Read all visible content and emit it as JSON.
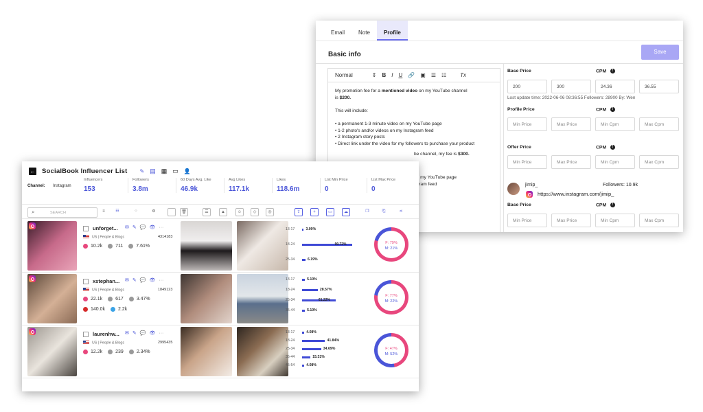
{
  "profile_window": {
    "tabs": [
      "Email",
      "Note",
      "Profile"
    ],
    "active_tab": "Profile",
    "section_title": "Basic info",
    "save_label": "Save",
    "editor_toolbar": {
      "format": "Normal",
      "bold": "B",
      "italic": "I",
      "underline": "U",
      "clear": "Tx"
    },
    "editor_lines": [
      {
        "pre": "My promotion fee for a ",
        "bold": "mentioned video",
        "post": " on my YouTube channel"
      },
      {
        "pre": "is ",
        "bold": "$200.",
        "post": ""
      },
      {
        "pre": "",
        "bold": "",
        "post": ""
      },
      {
        "pre": "This will include:",
        "bold": "",
        "post": ""
      },
      {
        "pre": "",
        "bold": "",
        "post": ""
      },
      {
        "pre": "• a permanent 1-3 minute video on my YouTube page",
        "bold": "",
        "post": ""
      },
      {
        "pre": "• 1-2 photo's and/or videos on my Instagram feed",
        "bold": "",
        "post": ""
      },
      {
        "pre": "• 2 Instagram story posts",
        "bold": "",
        "post": ""
      },
      {
        "pre": "• Direct link under the video for my followers to purchase your product",
        "bold": "",
        "post": ""
      }
    ],
    "editor_hidden_lines": [
      {
        "text": "be channel, my fee is ",
        "bold": "$300."
      },
      {
        "text": "on my YouTube page",
        "bold": ""
      },
      {
        "text": "agram feed",
        "bold": ""
      }
    ],
    "base_price_label": "Base Price",
    "cpm_label": "CPM",
    "base_prices": [
      "200",
      "300",
      "24.36",
      "36.55"
    ],
    "update_note": "Lost update time: 2022-06-06 08:36:55 Followers: 28900 By: Wen",
    "profile_price_label": "Profile Price",
    "offer_price_label": "Offer Price",
    "placeholders": {
      "min_price": "Min Price",
      "max_price": "Max Price",
      "min_cpm": "Min Cpm",
      "max_cpm": "Max Cpm"
    },
    "account": {
      "handle": "jimip_",
      "followers": "Followers: 10.9k",
      "url": "https://www.instagram.com/jimip_"
    },
    "account_base_price_label": "Base Price",
    "account_cpm_label": "CPM"
  },
  "list_window": {
    "title": "SocialBook Influencer List",
    "channel_label": "Channel:",
    "channel_value": "Instagram",
    "stats": [
      {
        "label": "Influencers",
        "value": "153"
      },
      {
        "label": "Followers",
        "value": "3.8m"
      },
      {
        "label": "60 Days Avg. Like",
        "value": "46.9k"
      },
      {
        "label": "Avg Likes",
        "value": "117.1k"
      },
      {
        "label": "Likes",
        "value": "118.6m"
      },
      {
        "label": "List Min Price",
        "value": "0"
      },
      {
        "label": "List Max Price",
        "value": "0"
      }
    ],
    "search_placeholder": "SEARCH",
    "influencers": [
      {
        "name": "unforget...",
        "category": "US | People & Blogs",
        "id": "4314183",
        "followers": "10.2k",
        "likes": "711",
        "engagement": "7.61%",
        "yt": "",
        "tw": "",
        "ages": [
          {
            "range": "13-17",
            "pct": "3.09%",
            "v": 3.09
          },
          {
            "range": "18-24",
            "pct": "90.72%",
            "v": 90.72
          },
          {
            "range": "25-34",
            "pct": "6.19%",
            "v": 6.19
          }
        ],
        "female": "F: 79%",
        "male": "M: 21%",
        "female_frac": 0.79
      },
      {
        "name": "xstephan...",
        "category": "US | People & Blogs",
        "id": "1849123",
        "followers": "22.1k",
        "likes": "617",
        "engagement": "3.47%",
        "yt": "140.0k",
        "tw": "2.2k",
        "ages": [
          {
            "range": "13-17",
            "pct": "5.10%",
            "v": 5.1
          },
          {
            "range": "18-24",
            "pct": "28.57%",
            "v": 28.57
          },
          {
            "range": "25-34",
            "pct": "61.22%",
            "v": 61.22
          },
          {
            "range": "35-44",
            "pct": "5.10%",
            "v": 5.1
          }
        ],
        "female": "F: 77%",
        "male": "M: 22%",
        "female_frac": 0.77
      },
      {
        "name": "laurenhw...",
        "category": "US | People & Blogs",
        "id": "2995435",
        "followers": "12.2k",
        "likes": "239",
        "engagement": "2.34%",
        "yt": "",
        "tw": "",
        "ages": [
          {
            "range": "13-17",
            "pct": "4.08%",
            "v": 4.08
          },
          {
            "range": "18-24",
            "pct": "41.84%",
            "v": 41.84
          },
          {
            "range": "25-34",
            "pct": "34.69%",
            "v": 34.69
          },
          {
            "range": "35-44",
            "pct": "15.31%",
            "v": 15.31
          },
          {
            "range": "45-54",
            "pct": "4.08%",
            "v": 4.08
          }
        ],
        "female": "F: 47%",
        "male": "M: 52%",
        "female_frac": 0.47
      }
    ],
    "colors": {
      "accent": "#4a55d8",
      "female": "#e8477d",
      "male": "#4a55d8"
    }
  }
}
